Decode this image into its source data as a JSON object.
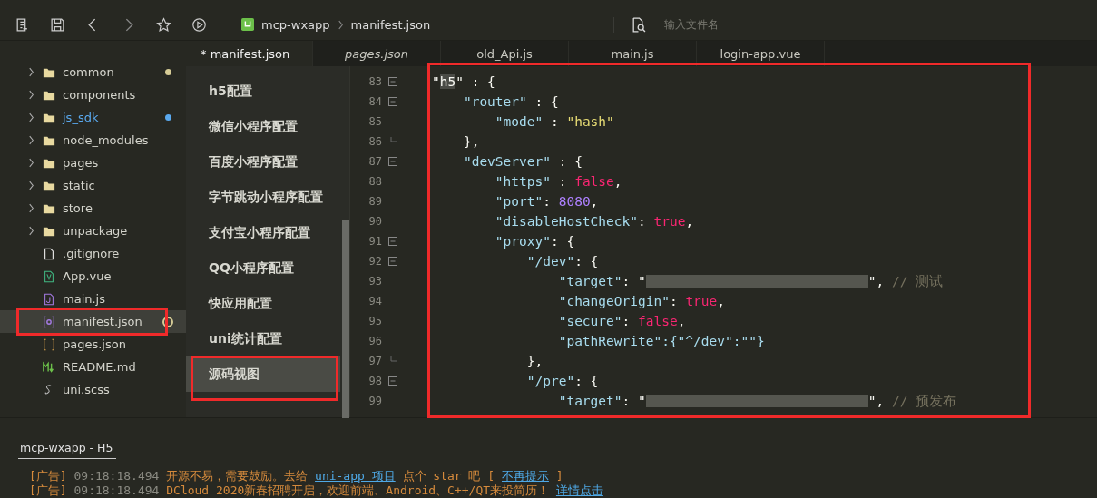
{
  "toolbar": {
    "breadcrumb": [
      "mcp-wxapp",
      "manifest.json"
    ],
    "search": {
      "placeholder": "输入文件名"
    }
  },
  "tabs": [
    {
      "label": "* manifest.json",
      "selected": true,
      "preview": false
    },
    {
      "label": "pages.json",
      "selected": false,
      "preview": true
    },
    {
      "label": "old_Api.js",
      "selected": false,
      "preview": false
    },
    {
      "label": "main.js",
      "selected": false,
      "preview": false
    },
    {
      "label": "login-app.vue",
      "selected": false,
      "preview": false
    }
  ],
  "file_tree": [
    {
      "name": "common",
      "kind": "folder",
      "selected": false,
      "added": false,
      "color": "#d6cc96"
    },
    {
      "name": "components",
      "kind": "folder",
      "selected": false,
      "added": false
    },
    {
      "name": "js_sdk",
      "kind": "folder",
      "selected": false,
      "added": true,
      "color": "#5aa9ee"
    },
    {
      "name": "node_modules",
      "kind": "folder",
      "selected": false,
      "added": false
    },
    {
      "name": "pages",
      "kind": "folder",
      "selected": false,
      "added": false
    },
    {
      "name": "static",
      "kind": "folder",
      "selected": false,
      "added": false
    },
    {
      "name": "store",
      "kind": "folder",
      "selected": false,
      "added": false
    },
    {
      "name": "unpackage",
      "kind": "folder",
      "selected": false,
      "added": false
    },
    {
      "name": ".gitignore",
      "kind": "plain",
      "selected": false,
      "added": false
    },
    {
      "name": "App.vue",
      "kind": "vue",
      "selected": false,
      "added": false
    },
    {
      "name": "main.js",
      "kind": "js",
      "selected": false,
      "added": false
    },
    {
      "name": "manifest.json",
      "kind": "manifest",
      "selected": true,
      "added": false,
      "color": "#d6cc96"
    },
    {
      "name": "pages.json",
      "kind": "json",
      "selected": false,
      "added": false
    },
    {
      "name": "README.md",
      "kind": "markdown",
      "selected": false,
      "added": false
    },
    {
      "name": "uni.scss",
      "kind": "scss",
      "selected": false,
      "added": false
    }
  ],
  "config_nav": [
    {
      "label": "h5配置",
      "selected": false
    },
    {
      "label": "微信小程序配置",
      "selected": false
    },
    {
      "label": "百度小程序配置",
      "selected": false
    },
    {
      "label": "字节跳动小程序配置",
      "selected": false
    },
    {
      "label": "支付宝小程序配置",
      "selected": false
    },
    {
      "label": "QQ小程序配置",
      "selected": false
    },
    {
      "label": "快应用配置",
      "selected": false
    },
    {
      "label": "uni统计配置",
      "selected": false
    },
    {
      "label": "源码视图",
      "selected": true
    }
  ],
  "code_lines": [
    {
      "number": "83",
      "kind": "start",
      "tokens": [
        {
          "kind": "plain",
          "text": "\""
        },
        {
          "kind": "match",
          "text": "h5"
        },
        {
          "kind": "plain",
          "text": "\" : {"
        }
      ]
    },
    {
      "number": "84",
      "kind": "start",
      "tokens": [
        {
          "kind": "key",
          "text": "    \"router\""
        },
        {
          "kind": "plain",
          "text": " : {"
        }
      ]
    },
    {
      "number": "85",
      "kind": "plain",
      "tokens": [
        {
          "kind": "key",
          "text": "        \"mode\""
        },
        {
          "kind": "plain",
          "text": " : "
        },
        {
          "kind": "string",
          "text": "\"hash\""
        }
      ]
    },
    {
      "number": "86",
      "kind": "end",
      "tokens": [
        {
          "kind": "plain",
          "text": "    },"
        }
      ]
    },
    {
      "number": "87",
      "kind": "start",
      "tokens": [
        {
          "kind": "key",
          "text": "    \"devServer\""
        },
        {
          "kind": "plain",
          "text": " : {"
        }
      ]
    },
    {
      "number": "88",
      "kind": "plain",
      "tokens": [
        {
          "kind": "key",
          "text": "        \"https\""
        },
        {
          "kind": "plain",
          "text": " : "
        },
        {
          "kind": "boolean",
          "text": "false"
        },
        {
          "kind": "plain",
          "text": ","
        }
      ]
    },
    {
      "number": "89",
      "kind": "plain",
      "tokens": [
        {
          "kind": "key",
          "text": "        \"port\""
        },
        {
          "kind": "plain",
          "text": ": "
        },
        {
          "kind": "number",
          "text": "8080"
        },
        {
          "kind": "plain",
          "text": ","
        }
      ]
    },
    {
      "number": "90",
      "kind": "plain",
      "tokens": [
        {
          "kind": "key",
          "text": "        \"disableHostCheck\""
        },
        {
          "kind": "plain",
          "text": ": "
        },
        {
          "kind": "boolean",
          "text": "true"
        },
        {
          "kind": "plain",
          "text": ","
        }
      ]
    },
    {
      "number": "91",
      "kind": "start",
      "tokens": [
        {
          "kind": "key",
          "text": "        \"proxy\""
        },
        {
          "kind": "plain",
          "text": ": {"
        }
      ]
    },
    {
      "number": "92",
      "kind": "start",
      "tokens": [
        {
          "kind": "key",
          "text": "            \"/dev\""
        },
        {
          "kind": "plain",
          "text": ": {"
        }
      ]
    },
    {
      "number": "93",
      "kind": "plain",
      "tokens": [
        {
          "kind": "key",
          "text": "                \"target\""
        },
        {
          "kind": "plain",
          "text": ": \""
        },
        {
          "kind": "blurred"
        },
        {
          "kind": "plain",
          "text": "\", "
        },
        {
          "kind": "comment",
          "text": "// 测试"
        }
      ]
    },
    {
      "number": "94",
      "kind": "plain",
      "tokens": [
        {
          "kind": "key",
          "text": "                \"changeOrigin\""
        },
        {
          "kind": "plain",
          "text": ": "
        },
        {
          "kind": "boolean",
          "text": "true"
        },
        {
          "kind": "plain",
          "text": ","
        }
      ]
    },
    {
      "number": "95",
      "kind": "plain",
      "tokens": [
        {
          "kind": "key",
          "text": "                \"secure\""
        },
        {
          "kind": "plain",
          "text": ": "
        },
        {
          "kind": "boolean",
          "text": "false"
        },
        {
          "kind": "plain",
          "text": ","
        }
      ]
    },
    {
      "number": "96",
      "kind": "plain",
      "tokens": [
        {
          "kind": "key",
          "text": "                \"pathRewrite\":{\"^/dev\":\"\"}"
        }
      ]
    },
    {
      "number": "97",
      "kind": "end",
      "tokens": [
        {
          "kind": "plain",
          "text": "            },"
        }
      ]
    },
    {
      "number": "98",
      "kind": "start",
      "tokens": [
        {
          "kind": "key",
          "text": "            \"/pre\""
        },
        {
          "kind": "plain",
          "text": ": {"
        }
      ]
    },
    {
      "number": "99",
      "kind": "plain",
      "tokens": [
        {
          "kind": "key",
          "text": "                \"target\""
        },
        {
          "kind": "plain",
          "text": ": \""
        },
        {
          "kind": "blurred"
        },
        {
          "kind": "plain",
          "text": "\", "
        },
        {
          "kind": "comment",
          "text": "// 预发布"
        }
      ]
    }
  ],
  "console": {
    "tab": "mcp-wxapp - H5",
    "lines": [
      [
        {
          "kind": "tag",
          "text": "[广告]"
        },
        {
          "kind": "time",
          "text": "09:18:18.494"
        },
        {
          "kind": "text",
          "text": "开源不易，需要鼓励。去给"
        },
        {
          "kind": "link",
          "text": "uni-app 项目"
        },
        {
          "kind": "text",
          "text": "点个 star 吧 ["
        },
        {
          "kind": "link",
          "text": "不再提示"
        },
        {
          "kind": "text",
          "text": "]"
        }
      ],
      [
        {
          "kind": "tag",
          "text": "[广告]"
        },
        {
          "kind": "time",
          "text": "09:18:18.494"
        },
        {
          "kind": "text",
          "text": "DCloud 2020新春招聘开启，欢迎前端、Android、C++/QT来投简历！"
        },
        {
          "kind": "link",
          "text": "详情点击"
        }
      ]
    ]
  }
}
